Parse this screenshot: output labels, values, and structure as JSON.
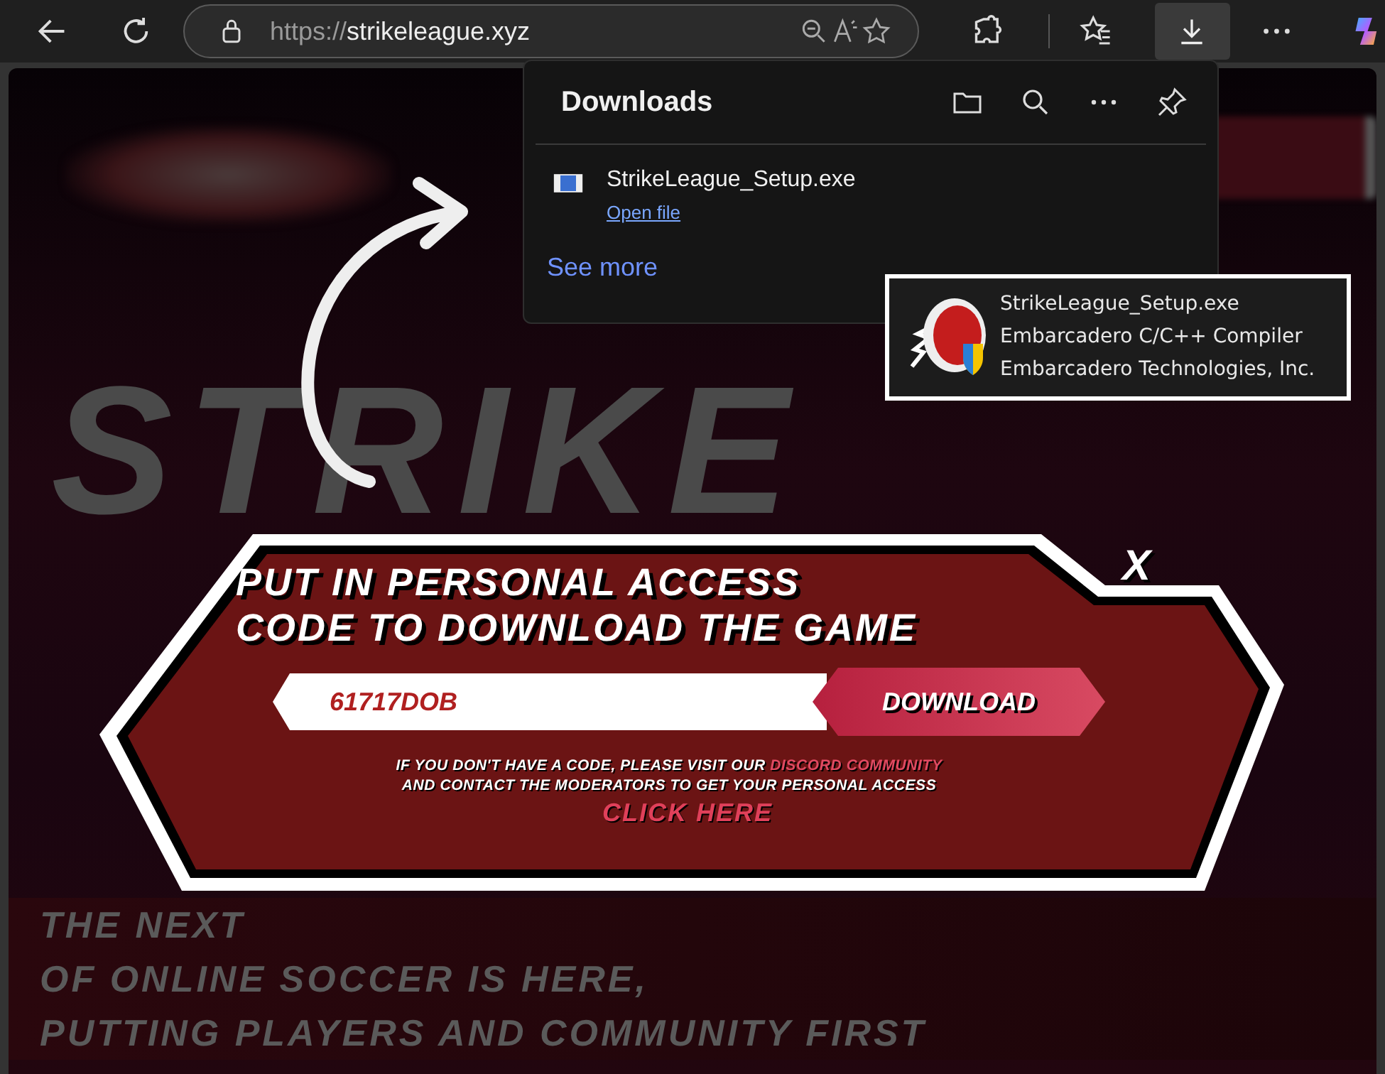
{
  "toolbar": {
    "address": {
      "scheme": "https://",
      "host": "strikeleague.xyz"
    },
    "downloads_button": {
      "selected": true
    }
  },
  "downloads_panel": {
    "title": "Downloads",
    "items": [
      {
        "name": "StrikeLeague_Setup.exe",
        "action": "Open file"
      }
    ],
    "see_more": "See more"
  },
  "tooltip": {
    "lines": [
      "StrikeLeague_Setup.exe",
      "Embarcadero C/C++ Compiler",
      "Embarcadero Technologies, Inc."
    ]
  },
  "background": {
    "headline": "STRIKE",
    "lines": [
      "THE NEXT",
      "OF ONLINE SOCCER IS HERE,",
      "PUTTING PLAYERS AND COMMUNITY FIRST"
    ]
  },
  "modal": {
    "close": "X",
    "title_lines": [
      "PUT IN PERSONAL ACCESS",
      "CODE TO DOWNLOAD THE GAME"
    ],
    "code_field": {
      "value": "61717DOB"
    },
    "download_button": "DOWNLOAD",
    "help_text": "IF YOU DON'T HAVE A CODE, PLEASE VISIT OUR",
    "help_link": "DISCORD COMMUNITY",
    "help_text_2": "AND CONTACT THE MODERATORS TO GET YOUR PERSONAL ACCESS",
    "click_here": "CLICK HERE"
  }
}
